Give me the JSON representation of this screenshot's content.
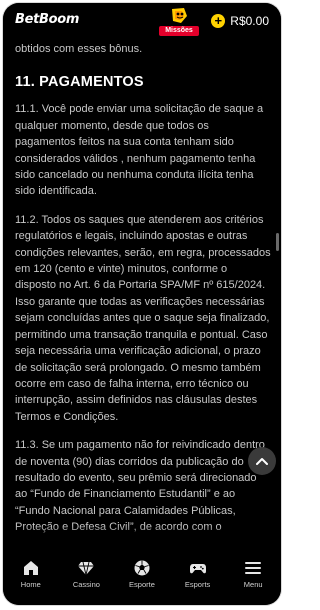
{
  "header": {
    "logo": "BetBoom",
    "missions_label": "Missões",
    "balance": "R$0.00",
    "plus_icon": "plus-circle-icon"
  },
  "content": {
    "intro_tail": "obtidos com esses bônus.",
    "section_title": "11. PAGAMENTOS",
    "paragraphs": [
      "11.1. Você pode enviar uma solicitação de saque a qualquer momento, desde que todos os pagamentos feitos na sua conta tenham sido considerados válidos , nenhum pagamento tenha sido cancelado ou nenhuma conduta ilícita tenha sido identificada.",
      "11.2. Todos os saques que atenderem aos critérios regulatórios e legais, incluindo apostas e outras condições relevantes, serão, em regra, processados em 120 (cento e vinte) minutos, conforme o disposto no Art. 6 da Portaria SPA/MF nº 615/2024. Isso garante que todas as verificações necessárias sejam concluídas antes que o saque seja finalizado, permitindo uma transação tranquila e pontual. Caso seja necessária uma verificação adicional, o prazo de solicitação será prolongado. O mesmo também ocorre em caso de falha interna, erro técnico ou interrupção, assim definidos nas cláusulas destes Termos e Condições.",
      "11.3. Se um pagamento não for reivindicado dentro de noventa (90) dias corridos da publicação do resultado do evento, seu prêmio será direcionado ao “Fundo de Financiamento Estudantil” e ao “Fundo Nacional para Calamidades Públicas, Proteção e Defesa Civil”, de acordo com o"
    ]
  },
  "nav": [
    {
      "label": "Home",
      "icon": "home-icon"
    },
    {
      "label": "Cassino",
      "icon": "diamond-icon"
    },
    {
      "label": "Esporte",
      "icon": "soccer-ball-icon"
    },
    {
      "label": "Esports",
      "icon": "gamepad-icon"
    },
    {
      "label": "Menu",
      "icon": "hamburger-menu-icon"
    }
  ],
  "colors": {
    "background": "#000000",
    "text": "#c8c8c8",
    "heading": "#ffffff",
    "accent_red": "#e4002b",
    "accent_yellow": "#ffd200"
  }
}
